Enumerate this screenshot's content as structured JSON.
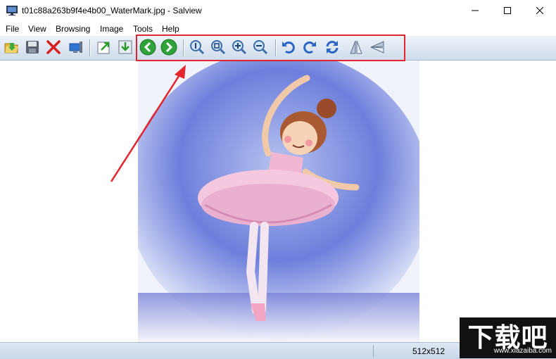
{
  "window": {
    "title": "t01c88a263b9f4e4b00_WaterMark.jpg - Salview"
  },
  "menu": [
    "File",
    "View",
    "Browsing",
    "Image",
    "Tools",
    "Help"
  ],
  "toolbar": {
    "buttons": [
      {
        "name": "open-folder",
        "icon": "folder-open-icon"
      },
      {
        "name": "save",
        "icon": "floppy-disk-icon"
      },
      {
        "name": "delete",
        "icon": "red-x-icon"
      },
      {
        "name": "set-desktop",
        "icon": "monitor-icon"
      },
      {
        "name": "export",
        "icon": "export-arrow-icon"
      },
      {
        "name": "import",
        "icon": "import-down-icon"
      },
      {
        "name": "previous",
        "icon": "green-left-arrow-icon"
      },
      {
        "name": "next",
        "icon": "green-right-arrow-icon"
      },
      {
        "name": "zoom-actual",
        "icon": "magnifier-1-icon"
      },
      {
        "name": "zoom-fit",
        "icon": "magnifier-fit-icon"
      },
      {
        "name": "zoom-in",
        "icon": "magnifier-plus-icon"
      },
      {
        "name": "zoom-out",
        "icon": "magnifier-minus-icon"
      },
      {
        "name": "rotate-left",
        "icon": "rotate-ccw-icon"
      },
      {
        "name": "rotate-right",
        "icon": "rotate-cw-icon"
      },
      {
        "name": "refresh",
        "icon": "refresh-icon"
      },
      {
        "name": "flip-horizontal",
        "icon": "flip-horizontal-icon"
      },
      {
        "name": "flip-vertical",
        "icon": "flip-vertical-icon"
      }
    ]
  },
  "status": {
    "dimensions": "512x512"
  },
  "watermark": {
    "text": "下载吧",
    "url": "www.xiazaiba.com"
  },
  "colors": {
    "highlight": "#e3252d",
    "toolbar_top": "#eef3fa",
    "toolbar_bottom": "#cfdceb"
  }
}
